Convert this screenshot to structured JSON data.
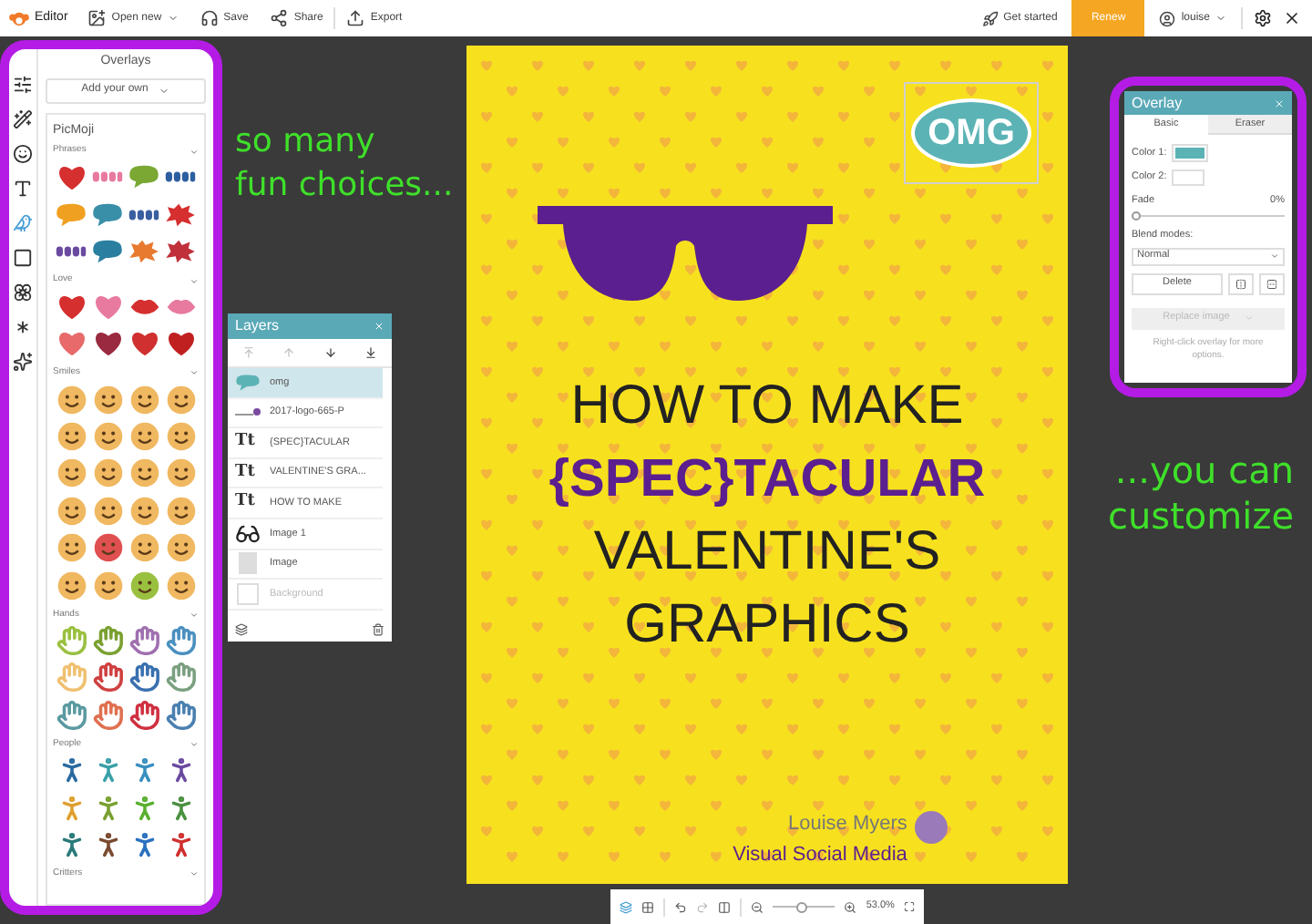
{
  "toolbar": {
    "app_name": "Editor",
    "left": [
      {
        "kind": "open",
        "label": "Open new",
        "dropdown": true
      },
      {
        "kind": "save",
        "label": "Save",
        "dropdown": false
      },
      {
        "kind": "share",
        "label": "Share",
        "dropdown": false
      },
      {
        "kind": "export",
        "label": "Export",
        "dropdown": false
      }
    ],
    "get_started": "Get started",
    "renew": "Renew",
    "user": "louise"
  },
  "sidebar": {
    "tools": [
      {
        "kind": "adjust",
        "selected": false
      },
      {
        "kind": "effects",
        "selected": false
      },
      {
        "kind": "touchup",
        "selected": false
      },
      {
        "kind": "text",
        "selected": false
      },
      {
        "kind": "overlays",
        "selected": true
      },
      {
        "kind": "frames",
        "selected": false
      },
      {
        "kind": "ornament",
        "selected": false
      },
      {
        "kind": "texture",
        "selected": false
      },
      {
        "kind": "themes",
        "selected": false
      }
    ],
    "title": "Overlays",
    "add_button": "Add your own",
    "library": "PicMoji",
    "sections": [
      {
        "title": "Phrases",
        "expanded": true,
        "items": [
          {
            "kind": "heart",
            "color": "#d62f2f"
          },
          {
            "kind": "word",
            "color": "#e87aa0"
          },
          {
            "kind": "bubble",
            "color": "#7aa833"
          },
          {
            "kind": "word",
            "color": "#2d5fa0"
          },
          {
            "kind": "bubble",
            "color": "#f0a020"
          },
          {
            "kind": "bubble",
            "color": "#3a8fa8"
          },
          {
            "kind": "word",
            "color": "#3a5fa0"
          },
          {
            "kind": "splat",
            "color": "#d62f2f"
          },
          {
            "kind": "word",
            "color": "#6a4aa0"
          },
          {
            "kind": "bubble",
            "color": "#2a7fa0"
          },
          {
            "kind": "splat",
            "color": "#e87a30"
          },
          {
            "kind": "splat",
            "color": "#c0303a"
          }
        ]
      },
      {
        "title": "Love",
        "expanded": true,
        "items": [
          {
            "kind": "heart",
            "color": "#d62f2f"
          },
          {
            "kind": "heart",
            "color": "#e87aa0"
          },
          {
            "kind": "lips",
            "color": "#d62f2f"
          },
          {
            "kind": "lips",
            "color": "#e87aa0"
          },
          {
            "kind": "heart",
            "color": "#e86a6a"
          },
          {
            "kind": "heart",
            "color": "#9a2a40"
          },
          {
            "kind": "heart",
            "color": "#d03030"
          },
          {
            "kind": "heart",
            "color": "#c02020"
          }
        ]
      },
      {
        "title": "Smiles",
        "expanded": true,
        "items": [
          {
            "kind": "face",
            "color": "#f0b860"
          },
          {
            "kind": "face",
            "color": "#f0b860"
          },
          {
            "kind": "face",
            "color": "#f0b860"
          },
          {
            "kind": "face",
            "color": "#f0b860"
          },
          {
            "kind": "face",
            "color": "#f0b860"
          },
          {
            "kind": "face",
            "color": "#f0b860"
          },
          {
            "kind": "face",
            "color": "#f0b860"
          },
          {
            "kind": "face",
            "color": "#f0b860"
          },
          {
            "kind": "face",
            "color": "#f0b860"
          },
          {
            "kind": "face",
            "color": "#f0b860"
          },
          {
            "kind": "face",
            "color": "#f0b860"
          },
          {
            "kind": "face",
            "color": "#f0b860"
          },
          {
            "kind": "face",
            "color": "#f0b860"
          },
          {
            "kind": "face",
            "color": "#f0b860"
          },
          {
            "kind": "face",
            "color": "#f0b860"
          },
          {
            "kind": "face",
            "color": "#f0b860"
          },
          {
            "kind": "face",
            "color": "#f0b860"
          },
          {
            "kind": "face",
            "color": "#e05050"
          },
          {
            "kind": "face",
            "color": "#f0b860"
          },
          {
            "kind": "face",
            "color": "#f0b860"
          },
          {
            "kind": "face",
            "color": "#f0b860"
          },
          {
            "kind": "face",
            "color": "#f0b860"
          },
          {
            "kind": "face",
            "color": "#9ac040"
          },
          {
            "kind": "face",
            "color": "#f0b860"
          }
        ]
      },
      {
        "title": "Hands",
        "expanded": true,
        "items": [
          {
            "kind": "hand",
            "color": "#9ac040"
          },
          {
            "kind": "hand",
            "color": "#7aa030"
          },
          {
            "kind": "hand",
            "color": "#a070b0"
          },
          {
            "kind": "hand",
            "color": "#4a90c0"
          },
          {
            "kind": "hand",
            "color": "#f0c070"
          },
          {
            "kind": "hand",
            "color": "#d04040"
          },
          {
            "kind": "hand",
            "color": "#3a70b0"
          },
          {
            "kind": "hand",
            "color": "#7aa080"
          },
          {
            "kind": "hand",
            "color": "#5a9aa0"
          },
          {
            "kind": "hand",
            "color": "#e07050"
          },
          {
            "kind": "hand",
            "color": "#d03040"
          },
          {
            "kind": "hand",
            "color": "#4a80b0"
          }
        ]
      },
      {
        "title": "People",
        "expanded": true,
        "items": [
          {
            "kind": "person",
            "color": "#2a6aa0"
          },
          {
            "kind": "person",
            "color": "#3aa0a8"
          },
          {
            "kind": "person",
            "color": "#3a8fc0"
          },
          {
            "kind": "person",
            "color": "#6a4aa0"
          },
          {
            "kind": "person",
            "color": "#e0a030"
          },
          {
            "kind": "person",
            "color": "#7aa030"
          },
          {
            "kind": "person",
            "color": "#5ab030"
          },
          {
            "kind": "person",
            "color": "#4a9040"
          },
          {
            "kind": "person",
            "color": "#2a7a7a"
          },
          {
            "kind": "person",
            "color": "#7a4a30"
          },
          {
            "kind": "person",
            "color": "#2a70c0"
          },
          {
            "kind": "person",
            "color": "#d03030"
          }
        ]
      },
      {
        "title": "Critters",
        "expanded": true
      }
    ]
  },
  "annotations": [
    {
      "text": "so many\nfun choices..."
    },
    {
      "text": "...you can\ncustomize"
    }
  ],
  "layers": {
    "title": "Layers",
    "rows": [
      {
        "kind": "overlay",
        "name": "omg",
        "selected": true
      },
      {
        "kind": "logo",
        "name": "2017-logo-665-P",
        "selected": false
      },
      {
        "kind": "text",
        "icon": "Tt",
        "name": "{SPEC}TACULAR",
        "selected": false
      },
      {
        "kind": "text",
        "icon": "Tt",
        "name": "VALENTINE'S GRA...",
        "selected": false
      },
      {
        "kind": "text",
        "icon": "Tt",
        "name": "HOW TO MAKE",
        "selected": false
      },
      {
        "kind": "glasses",
        "name": "Image 1",
        "selected": false
      },
      {
        "kind": "image",
        "name": "Image",
        "selected": false
      },
      {
        "kind": "background",
        "name": "Background",
        "selected": false
      }
    ]
  },
  "poster": {
    "bubble": "OMG",
    "lines": [
      {
        "kind": "plain",
        "text": "HOW TO MAKE"
      },
      {
        "kind": "bold",
        "text": "{SPEC}TACULAR"
      },
      {
        "kind": "plain",
        "text": "VALENTINE'S"
      },
      {
        "kind": "plain",
        "text": "GRAPHICS"
      }
    ],
    "logo_name": "Louise Myers",
    "logo_tagline": "Visual Social Media"
  },
  "overlay_panel": {
    "title": "Overlay",
    "tabs": [
      {
        "label": "Basic",
        "selected": true
      },
      {
        "label": "Eraser",
        "selected": false
      }
    ],
    "color1_label": "Color 1:",
    "color2_label": "Color 2:",
    "fade_label": "Fade",
    "fade_value": "0%",
    "fade": {
      "level": 0
    },
    "blend_label": "Blend modes:",
    "blend_value": "Normal",
    "delete": "Delete",
    "replace": "Replace image",
    "hint": "Right-click overlay for more options."
  },
  "zoom_bar": {
    "zoom": {
      "level": 0.45
    },
    "value": "53.0%"
  }
}
